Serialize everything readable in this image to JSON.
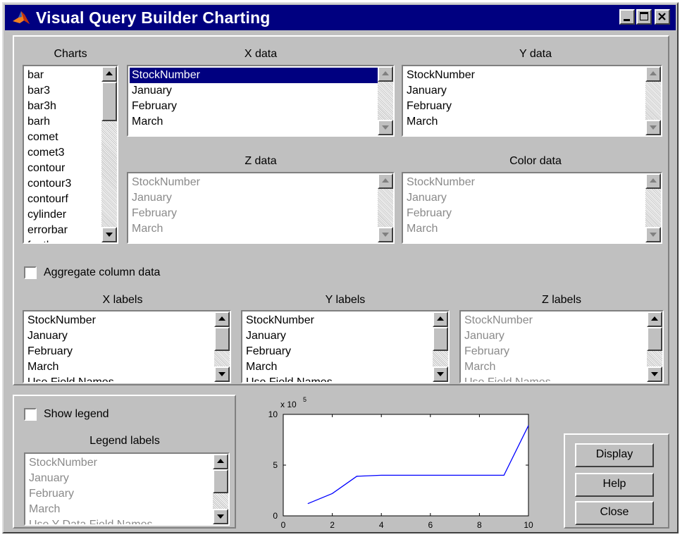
{
  "window": {
    "title": "Visual Query Builder Charting"
  },
  "charts": {
    "label": "Charts",
    "items": [
      "bar",
      "bar3",
      "bar3h",
      "barh",
      "comet",
      "comet3",
      "contour",
      "contour3",
      "contourf",
      "cylinder",
      "errorbar",
      "feather"
    ]
  },
  "xdata": {
    "label": "X data",
    "items": [
      "StockNumber",
      "January",
      "February",
      "March"
    ],
    "selected": "StockNumber"
  },
  "ydata": {
    "label": "Y data",
    "items": [
      "StockNumber",
      "January",
      "February",
      "March"
    ]
  },
  "zdata": {
    "label": "Z data",
    "items": [
      "StockNumber",
      "January",
      "February",
      "March"
    ]
  },
  "colordata": {
    "label": "Color data",
    "items": [
      "StockNumber",
      "January",
      "February",
      "March"
    ]
  },
  "aggregate": {
    "label": "Aggregate column data",
    "checked": false
  },
  "xlabels": {
    "label": "X labels",
    "items": [
      "StockNumber",
      "January",
      "February",
      "March",
      "Use Field Names"
    ]
  },
  "ylabels": {
    "label": "Y labels",
    "items": [
      "StockNumber",
      "January",
      "February",
      "March",
      "Use Field Names"
    ]
  },
  "zlabels": {
    "label": "Z labels",
    "items": [
      "StockNumber",
      "January",
      "February",
      "March",
      "Use Field Names"
    ]
  },
  "legend": {
    "show_label": "Show legend",
    "checked": false,
    "labels_title": "Legend labels",
    "items": [
      "StockNumber",
      "January",
      "February",
      "March",
      "Use Y Data Field Names"
    ]
  },
  "buttons": {
    "display": "Display",
    "help": "Help",
    "close": "Close"
  },
  "colors": {
    "titlebar": "#000080",
    "line": "#0000ff",
    "face": "#c0c0c0"
  },
  "chart_data": {
    "type": "line",
    "x": [
      1,
      2,
      3,
      4,
      5,
      6,
      7,
      8,
      9,
      10
    ],
    "y": [
      1.2,
      2.2,
      3.9,
      4.0,
      4.0,
      4.0,
      4.0,
      4.0,
      4.0,
      8.9
    ],
    "xlim": [
      0,
      10
    ],
    "ylim": [
      0,
      10
    ],
    "xticks": [
      "0",
      "2",
      "4",
      "6",
      "8",
      "10"
    ],
    "yticks": [
      "0",
      "5",
      "10"
    ],
    "exponent_label": "x 10",
    "exponent_power": "5"
  }
}
